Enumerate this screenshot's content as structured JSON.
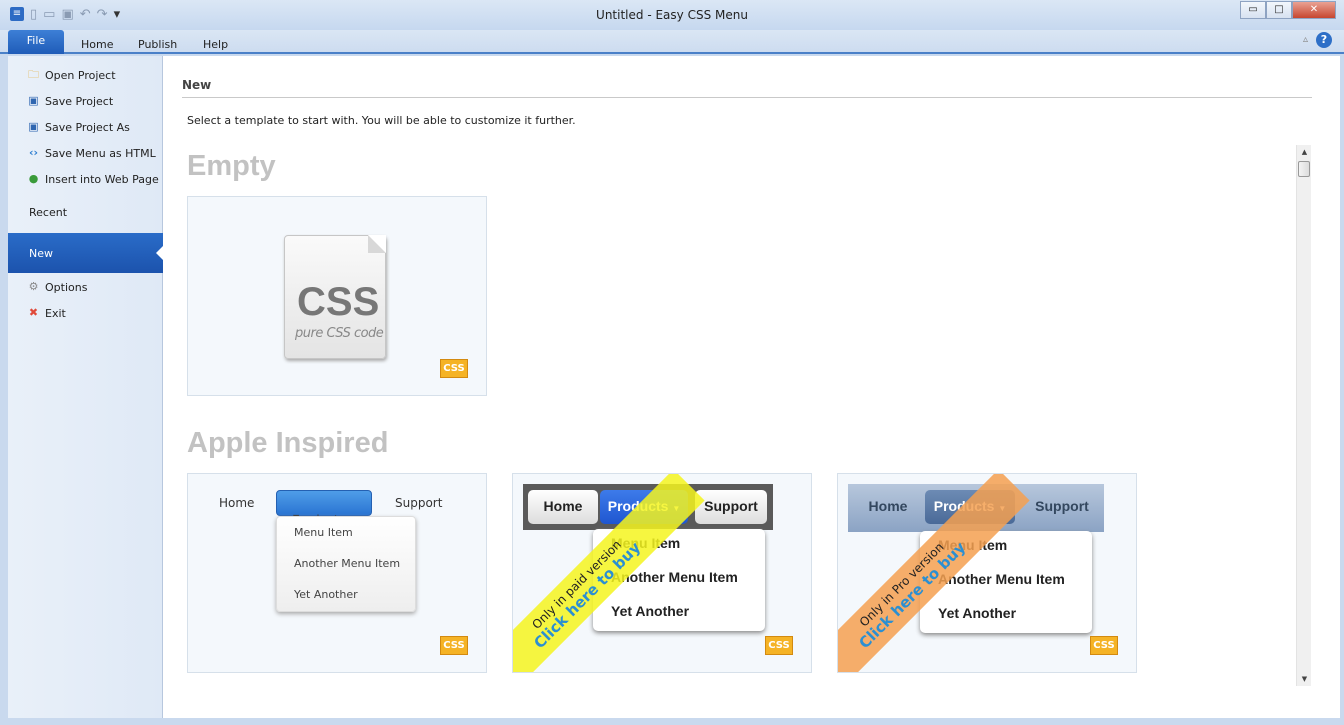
{
  "window": {
    "title": "Untitled - Easy CSS Menu",
    "minimize": "▭",
    "maximize": "□",
    "close": "✕"
  },
  "ribbon": {
    "tabs": [
      "File",
      "Home",
      "Publish",
      "Help"
    ],
    "help": "?"
  },
  "sidebar": {
    "items": [
      {
        "label": "Open Project",
        "icon": "folder-icon"
      },
      {
        "label": "Save Project",
        "icon": "save-icon"
      },
      {
        "label": "Save Project As",
        "icon": "save-as-icon"
      },
      {
        "label": "Save Menu as HTML",
        "icon": "code-icon"
      },
      {
        "label": "Insert into Web Page",
        "icon": "web-page-icon"
      }
    ],
    "recent": "Recent",
    "new": "New",
    "bottom": [
      {
        "label": "Options",
        "icon": "gear-icon"
      },
      {
        "label": "Exit",
        "icon": "exit-icon"
      }
    ]
  },
  "main": {
    "heading": "New",
    "subtitle": "Select a template to start with. You will be able to customize it further.",
    "sections": [
      "Empty",
      "Apple Inspired"
    ],
    "empty_card": {
      "big": "CSS",
      "small": "pure CSS code"
    },
    "badge": "CSS",
    "menu": {
      "home": "Home",
      "products": "Products",
      "support": "Support",
      "items": [
        "Menu Item",
        "Another Menu Item",
        "Yet Another"
      ]
    },
    "ribbon_paid": {
      "line1": "Only in paid version",
      "line2": "Click here to buy",
      "color": "#f5f52a"
    },
    "ribbon_pro": {
      "line1": "Only in Pro version",
      "line2": "Click here to buy",
      "color": "#f4a55a"
    }
  }
}
